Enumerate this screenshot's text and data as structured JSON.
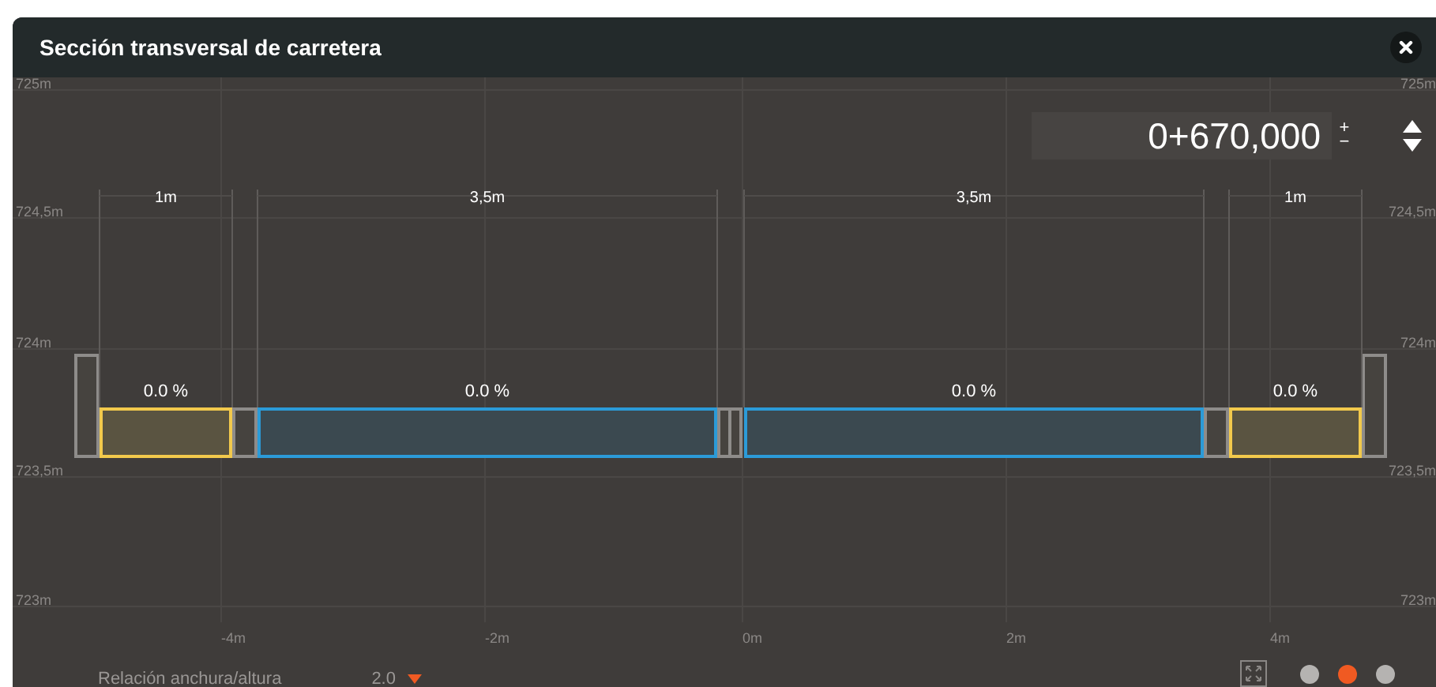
{
  "window": {
    "title": "Sección transversal de carretera"
  },
  "station": {
    "value": "0+670,000",
    "plus": "+",
    "minus": "−"
  },
  "y_ticks": [
    "725m",
    "724,5m",
    "724m",
    "723,5m",
    "723m"
  ],
  "y_ticks_right": [
    "725m",
    "724,5m",
    "724m",
    "723,5m",
    "723m"
  ],
  "x_ticks": [
    "-4m",
    "-2m",
    "0m",
    "2m",
    "4m"
  ],
  "segments": [
    {
      "kind": "curb"
    },
    {
      "kind": "shoulder",
      "width": "1m",
      "grade": "0.0 %"
    },
    {
      "kind": "gutter"
    },
    {
      "kind": "lane",
      "width": "3,5m",
      "grade": "0.0 %"
    },
    {
      "kind": "median"
    },
    {
      "kind": "lane",
      "width": "3,5m",
      "grade": "0.0 %"
    },
    {
      "kind": "gutter"
    },
    {
      "kind": "shoulder",
      "width": "1m",
      "grade": "0.0 %"
    },
    {
      "kind": "curb"
    }
  ],
  "ratio": {
    "label": "Relación anchura/altura",
    "value": "2.0"
  },
  "pages": [
    {
      "selected": false
    },
    {
      "selected": true
    },
    {
      "selected": false
    }
  ]
}
